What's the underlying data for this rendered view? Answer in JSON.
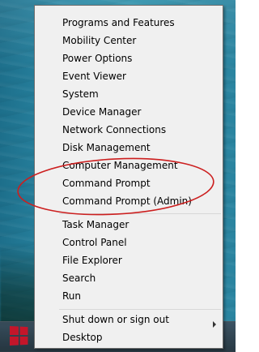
{
  "menu": {
    "items": [
      {
        "label": "Programs and Features"
      },
      {
        "label": "Mobility Center"
      },
      {
        "label": "Power Options"
      },
      {
        "label": "Event Viewer"
      },
      {
        "label": "System"
      },
      {
        "label": "Device Manager"
      },
      {
        "label": "Network Connections"
      },
      {
        "label": "Disk Management"
      },
      {
        "label": "Computer Management"
      },
      {
        "label": "Command Prompt"
      },
      {
        "label": "Command Prompt (Admin)"
      },
      {
        "label": "Task Manager"
      },
      {
        "label": "Control Panel"
      },
      {
        "label": "File Explorer"
      },
      {
        "label": "Search"
      },
      {
        "label": "Run"
      },
      {
        "label": "Shut down or sign out"
      },
      {
        "label": "Desktop"
      }
    ]
  },
  "colors": {
    "menu_background": "#f0f0f0",
    "annotation_ellipse": "#cc1f1f",
    "start_logo": "#c4162a"
  }
}
